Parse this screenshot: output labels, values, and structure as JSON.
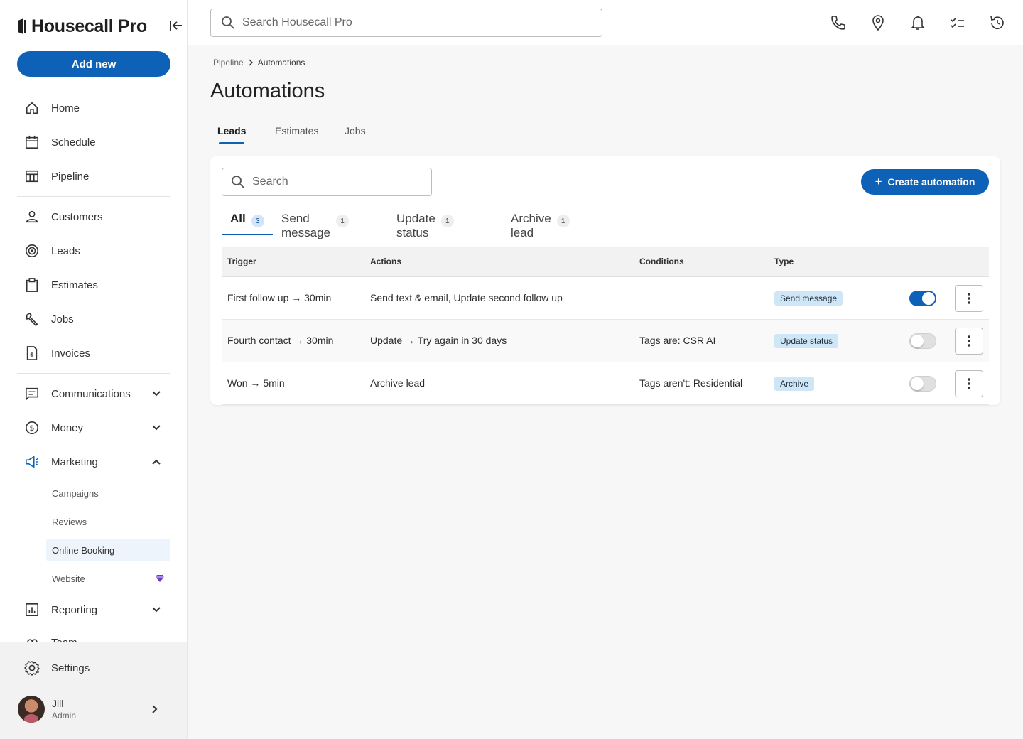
{
  "app": {
    "brand": "Housecall Pro"
  },
  "sidebar": {
    "add_new": "Add new",
    "items": [
      {
        "label": "Home",
        "icon": "home-icon"
      },
      {
        "label": "Schedule",
        "icon": "calendar-icon"
      },
      {
        "label": "Pipeline",
        "icon": "pipeline-icon"
      },
      {
        "label": "Customers",
        "icon": "person-icon"
      },
      {
        "label": "Leads",
        "icon": "target-icon"
      },
      {
        "label": "Estimates",
        "icon": "clipboard-icon"
      },
      {
        "label": "Jobs",
        "icon": "wrench-icon"
      },
      {
        "label": "Invoices",
        "icon": "invoice-icon"
      },
      {
        "label": "Communications",
        "icon": "chat-icon"
      },
      {
        "label": "Money",
        "icon": "dollar-icon"
      },
      {
        "label": "Marketing",
        "icon": "megaphone-icon"
      },
      {
        "label": "Reporting",
        "icon": "report-icon"
      },
      {
        "label": "Team",
        "icon": "team-icon"
      }
    ],
    "marketing_sub": [
      "Campaigns",
      "Reviews",
      "Online Booking",
      "Website"
    ],
    "settings": "Settings",
    "user": {
      "name": "Jill",
      "role": "Admin"
    }
  },
  "topbar": {
    "search_placeholder": "Search Housecall Pro"
  },
  "breadcrumb": {
    "parent": "Pipeline",
    "current": "Automations"
  },
  "page": {
    "title": "Automations",
    "tabs": [
      "Leads",
      "Estimates",
      "Jobs"
    ],
    "active_tab": "Leads"
  },
  "card": {
    "search_placeholder": "Search",
    "create_label": "Create automation",
    "filters": [
      {
        "label": "All",
        "count": "3"
      },
      {
        "label": "Send message",
        "count": "1"
      },
      {
        "label": "Update status",
        "count": "1"
      },
      {
        "label": "Archive lead",
        "count": "1"
      }
    ],
    "columns": [
      "Trigger",
      "Actions",
      "Conditions",
      "Type"
    ],
    "rows": [
      {
        "trigger": "First follow up → 30min",
        "actions": "Send text & email, Update second follow up",
        "conditions": "",
        "type": "Send message",
        "enabled": true
      },
      {
        "trigger": "Fourth contact → 30min",
        "actions": "Update → Try again in 30 days",
        "conditions": "Tags are: CSR AI",
        "type": "Update status",
        "enabled": false
      },
      {
        "trigger": "Won → 5min",
        "actions": "Archive lead",
        "conditions": "Tags aren't: Residential",
        "type": "Archive",
        "enabled": false
      }
    ]
  },
  "colors": {
    "primary": "#0d62b8",
    "tag_bg": "#cfe6f7",
    "sidebar_bg": "#ffffff",
    "page_bg": "#f7f7f7"
  }
}
